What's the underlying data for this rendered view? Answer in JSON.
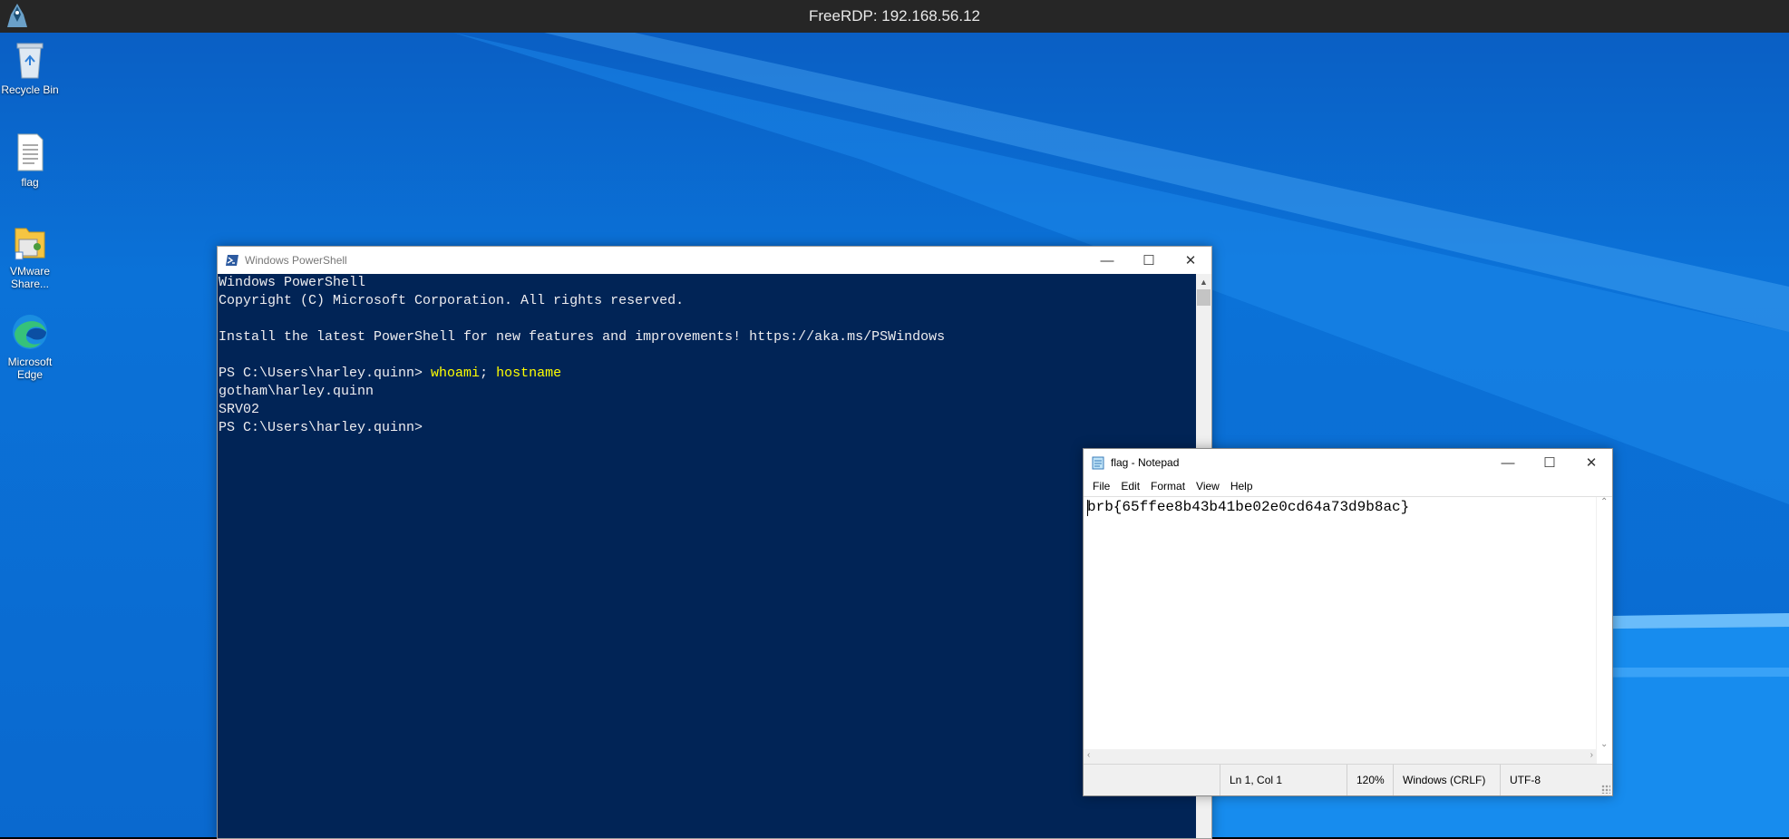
{
  "rdp": {
    "title": "FreeRDP: 192.168.56.12"
  },
  "desktop": {
    "icons": [
      {
        "label": "Recycle Bin",
        "icon": "recycle-bin-icon"
      },
      {
        "label": "flag",
        "icon": "text-file-icon"
      },
      {
        "label": "VMware Share...",
        "icon": "shared-folder-icon"
      },
      {
        "label": "Microsoft Edge",
        "icon": "edge-icon"
      }
    ]
  },
  "powershell": {
    "title": "Windows PowerShell",
    "lines": {
      "l1": "Windows PowerShell",
      "l2": "Copyright (C) Microsoft Corporation. All rights reserved.",
      "l3": "Install the latest PowerShell for new features and improvements! https://aka.ms/PSWindows",
      "prompt1": "PS C:\\Users\\harley.quinn> ",
      "cmd1": "whoami",
      "sep": "; ",
      "cmd2": "hostname",
      "out1": "gotham\\harley.quinn",
      "out2": "SRV02",
      "prompt2": "PS C:\\Users\\harley.quinn>"
    }
  },
  "notepad": {
    "title": "flag - Notepad",
    "menu": [
      "File",
      "Edit",
      "Format",
      "View",
      "Help"
    ],
    "content": "brb{65ffee8b43b41be02e0cd64a73d9b8ac}",
    "status": {
      "position": "Ln 1, Col 1",
      "zoom": "120%",
      "line_ending": "Windows (CRLF)",
      "encoding": "UTF-8"
    }
  },
  "colors": {
    "powershell_bg": "#012456",
    "desktop_blue": "#0a6fd6",
    "command_yellow": "#ffff00"
  }
}
